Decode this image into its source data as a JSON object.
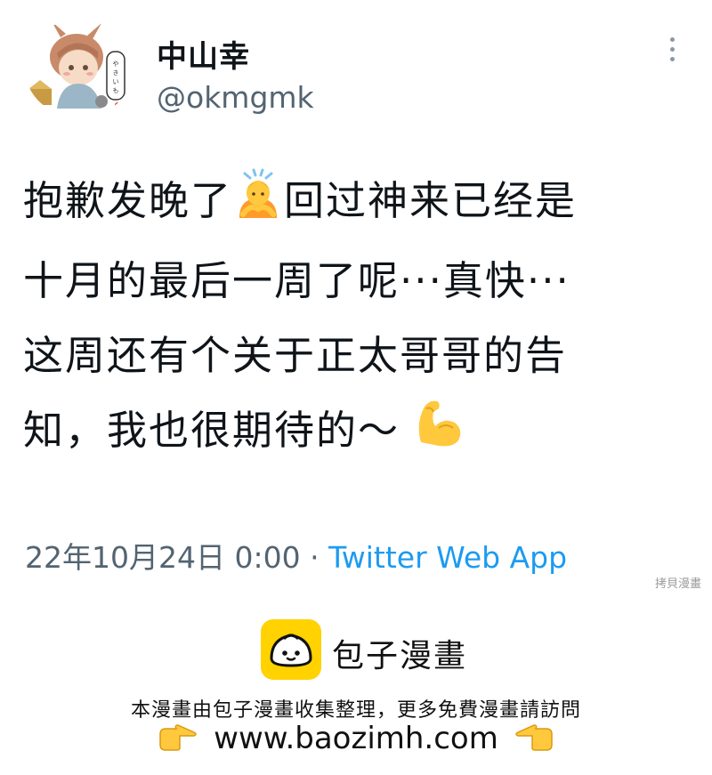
{
  "profile": {
    "display_name": "中山幸",
    "handle": "@okmgmk",
    "avatar_sign_text": "やきいも"
  },
  "tweet": {
    "line1_a": "抱歉发晚了",
    "line1_b": "回过神来已经是",
    "line2": "十月的最后一周了呢···真快···",
    "line3": "这周还有个关于正太哥哥的告",
    "line4": "知，我也很期待的～",
    "emoji_1": "person-raising-hand-icon",
    "emoji_2": "flexed-biceps-icon"
  },
  "meta": {
    "timestamp": "22年10月24日 0:00",
    "separator": "·",
    "app": "Twitter Web App"
  },
  "watermark": {
    "corner_mark": "拷貝漫畫",
    "brand_name": "包子漫畫",
    "notice": "本漫畫由包子漫畫收集整理，更多免費漫畫請訪問",
    "url": "www.baozimh.com",
    "pointer_icon": "pointing-hand-icon"
  },
  "colors": {
    "link": "#1d9bf0",
    "secondary_text": "#536471",
    "brand_yellow": "#ffd200"
  }
}
